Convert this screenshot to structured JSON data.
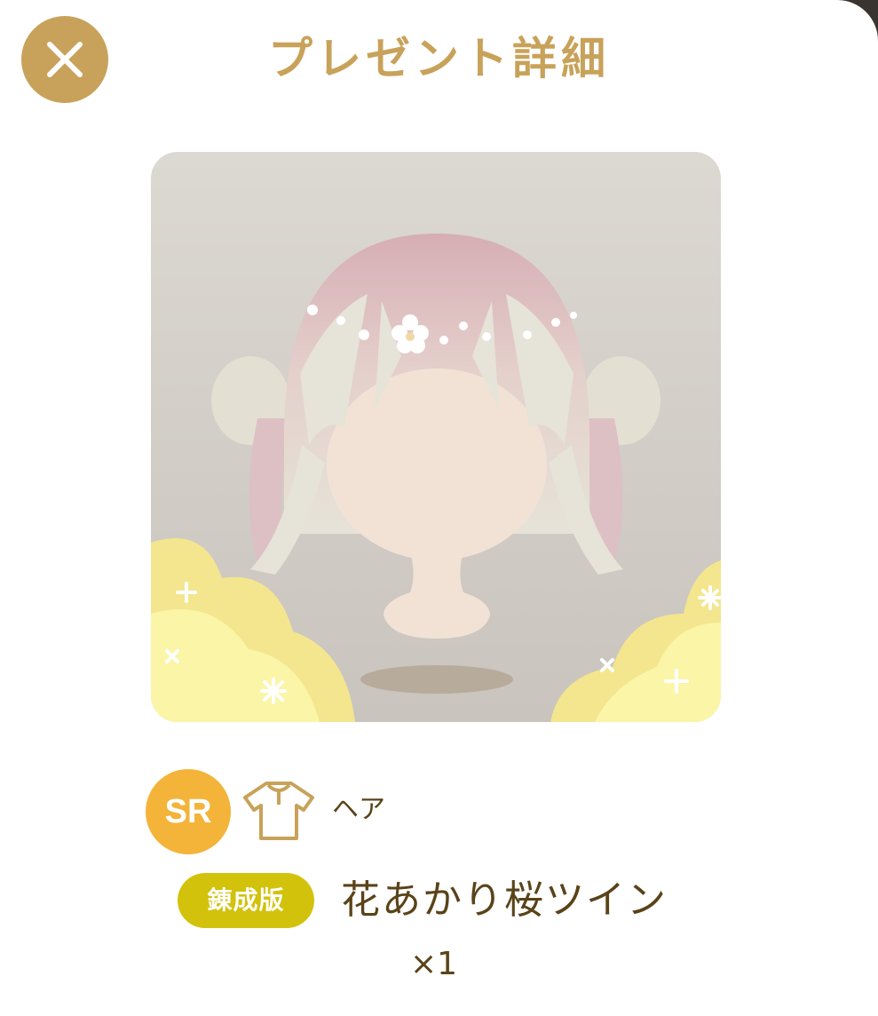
{
  "header": {
    "title": "プレゼント詳細",
    "close_icon": "close-icon"
  },
  "item": {
    "rarity": "SR",
    "category_icon": "shirt-icon",
    "category": "ヘア",
    "edition_badge": "錬成版",
    "name": "花あかり桜ツイン",
    "quantity": "×1"
  },
  "colors": {
    "accent_gold": "#c8a25a",
    "rarity_orange": "#f4b43a",
    "edition_yellow": "#d2c20c",
    "text_brown": "#5a4318"
  }
}
